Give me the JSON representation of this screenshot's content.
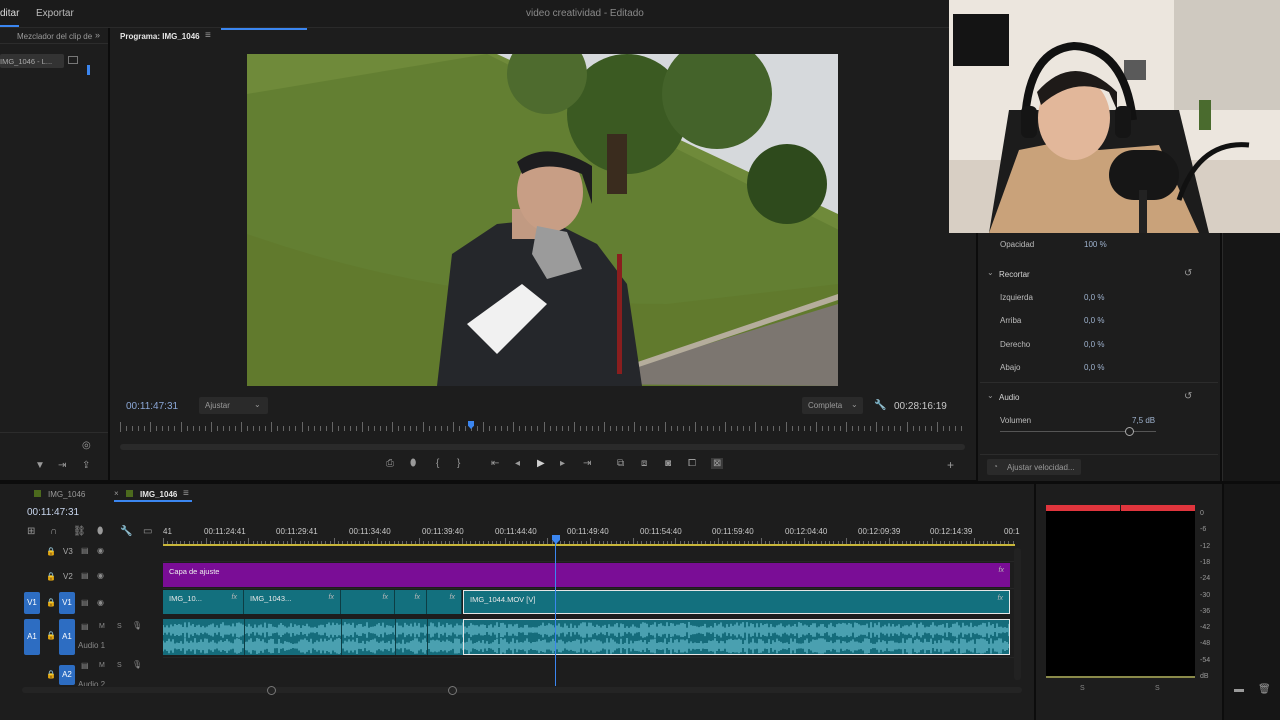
{
  "menu": {
    "edit": "ditar",
    "export": "Exportar"
  },
  "window_title": "video creatividad - Editado",
  "source_panel": {
    "tab_mixer": "Mezclador del clip de",
    "clip_item": "IMG_1046 - L..."
  },
  "program": {
    "title": "Programa: IMG_1046",
    "timecode_current": "00:11:47:31",
    "fit_label": "Ajustar",
    "quality_label": "Completa",
    "timecode_duration": "00:28:16:19"
  },
  "effects": {
    "opacity_label": "Opacidad",
    "opacity_value": "100 %",
    "crop_section": "Recortar",
    "left_label": "Izquierda",
    "left_value": "0,0 %",
    "top_label": "Arriba",
    "top_value": "0,0 %",
    "right_label": "Derecho",
    "right_value": "0,0 %",
    "bottom_label": "Abajo",
    "bottom_value": "0,0 %",
    "audio_section": "Audio",
    "volume_label": "Volumen",
    "volume_value": "7,5 dB",
    "speed_button": "Ajustar velocidad..."
  },
  "timeline": {
    "tab1": "IMG_1046",
    "tab2": "IMG_1046",
    "timecode": "00:11:47:31",
    "ruler": [
      "41",
      "00:11:24:41",
      "00:11:29:41",
      "00:11:34:40",
      "00:11:39:40",
      "00:11:44:40",
      "00:11:49:40",
      "00:11:54:40",
      "00:11:59:40",
      "00:12:04:40",
      "00:12:09:39",
      "00:12:14:39",
      "00:1"
    ],
    "tracks": {
      "v3": "V3",
      "v2": "V2",
      "v1": "V1",
      "v1_src": "V1",
      "a1": "A1",
      "a1_src": "A1",
      "a2": "A2",
      "audio1_name": "Audio 1",
      "audio2_name": "Audio 2",
      "m": "M",
      "s": "S"
    },
    "adjustment_layer": "Capa de ajuste",
    "clip1": "IMG_10...",
    "clip2": "IMG_1043...",
    "clip_main": "IMG_1044.MOV [V]",
    "fx": "fx"
  },
  "meter": {
    "scale": [
      "0",
      "-6",
      "-12",
      "-18",
      "-24",
      "-30",
      "-36",
      "-42",
      "-48",
      "-54",
      "dB"
    ],
    "s1": "S",
    "s2": "S"
  },
  "colors": {
    "accent_blue": "#2d6dc2",
    "playhead": "#3b86f0",
    "clip_video": "#13707e",
    "adjustment": "#7a0d96",
    "meter_peak": "#e0353d"
  }
}
